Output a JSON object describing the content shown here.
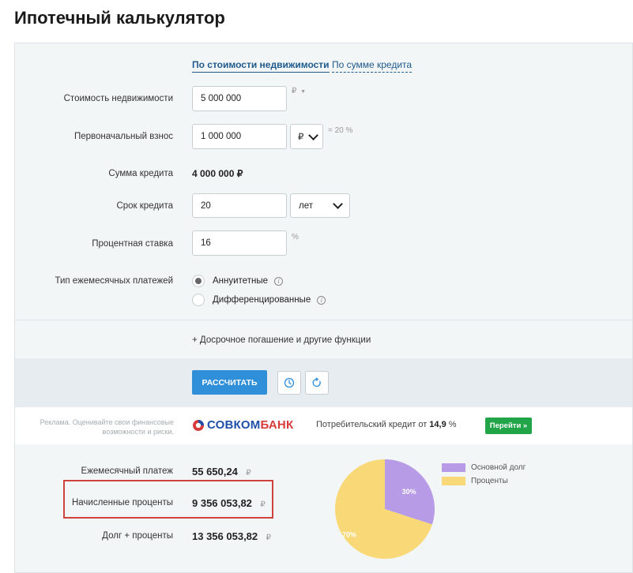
{
  "page": {
    "title": "Ипотечный калькулятор"
  },
  "tabs": [
    {
      "label": "По стоимости недвижимости",
      "active": true
    },
    {
      "label": "По сумме кредита",
      "active": false
    }
  ],
  "form": {
    "property_cost": {
      "label": "Стоимость недвижимости",
      "value": "5 000 000",
      "unit": "₽"
    },
    "down_payment": {
      "label": "Первоначальный взнос",
      "value": "1 000 000",
      "currency": "₽",
      "percent": "= 20 %"
    },
    "loan_amount": {
      "label": "Сумма кредита",
      "value": "4 000 000 ₽"
    },
    "term": {
      "label": "Срок кредита",
      "value": "20",
      "unit": "лет"
    },
    "rate": {
      "label": "Процентная ставка",
      "value": "16",
      "unit": "%"
    },
    "payment_type": {
      "label": "Тип ежемесячных платежей",
      "options": [
        {
          "label": "Аннуитетные",
          "selected": true
        },
        {
          "label": "Дифференцированные",
          "selected": false
        }
      ]
    },
    "extra_link": "+ Досрочное погашение и другие функции"
  },
  "actions": {
    "calculate": "РАССЧИТАТЬ"
  },
  "ad": {
    "text": "Реклама. Оценивайте свои финансовые возможности и риски.",
    "brand_part1": "СОВКОМ",
    "brand_part2": "БАНК",
    "offer_prefix": "Потребительский кредит от ",
    "offer_rate": "14,9",
    "offer_suffix": " %",
    "button": "Перейти »"
  },
  "results": {
    "monthly": {
      "label": "Ежемесячный платеж",
      "value": "55 650,24",
      "unit": "₽"
    },
    "interest": {
      "label": "Начисленные проценты",
      "value": "9 356 053,82",
      "unit": "₽"
    },
    "total": {
      "label": "Долг + проценты",
      "value": "13 356 053,82",
      "unit": "₽"
    }
  },
  "colors": {
    "principal": "#b79be6",
    "interest": "#f9d977",
    "accent": "#2f8fd8"
  },
  "chart_data": {
    "type": "pie",
    "slices": [
      {
        "name": "Основной долг",
        "value": 30,
        "label": "30%",
        "color": "#b79be6"
      },
      {
        "name": "Проценты",
        "value": 70,
        "label": "70%",
        "color": "#f9d977"
      }
    ]
  }
}
